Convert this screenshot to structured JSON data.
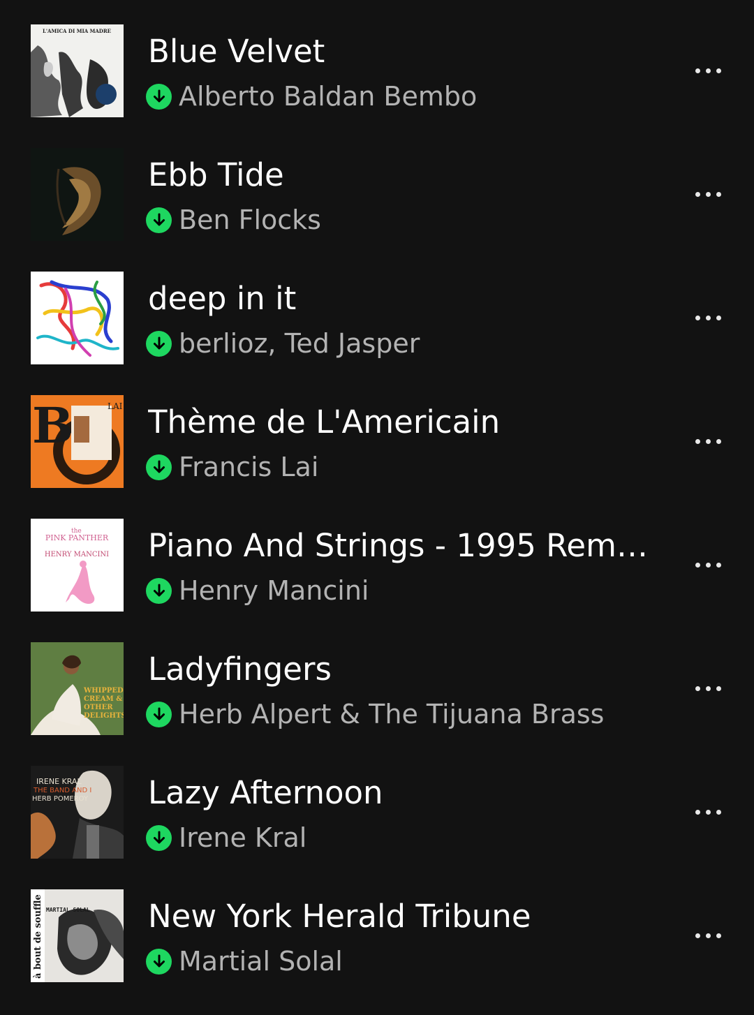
{
  "tracks": [
    {
      "title": "Blue Velvet",
      "artist": "Alberto Baldan Bembo",
      "cover_text": [
        "L'AMICA DI MIA MADRE"
      ]
    },
    {
      "title": "Ebb Tide",
      "artist": "Ben Flocks",
      "cover_text": []
    },
    {
      "title": "deep in it",
      "artist": "berlioz, Ted Jasper",
      "cover_text": []
    },
    {
      "title": "Thème de L'Americain",
      "artist": "Francis Lai",
      "cover_text": [
        "B",
        "O",
        "LAI"
      ]
    },
    {
      "title": "Piano And Strings - 1995 Rema...",
      "artist": "Henry Mancini",
      "cover_text": [
        "the",
        "PINK PANTHER",
        "HENRY MANCINI"
      ]
    },
    {
      "title": "Ladyfingers",
      "artist": "Herb Alpert & The Tijuana Brass",
      "cover_text": [
        "WHIPPED",
        "CREAM &",
        "OTHER",
        "DELIGHTS"
      ]
    },
    {
      "title": "Lazy Afternoon",
      "artist": "Irene Kral",
      "cover_text": [
        "IRENE KRAL",
        "THE BAND AND I",
        "HERB POMEROY"
      ]
    },
    {
      "title": "New York Herald Tribune",
      "artist": "Martial Solal",
      "cover_text": [
        "à bout de souffle",
        "MARTIAL SOLAL"
      ]
    }
  ],
  "icons": {
    "download": "download-icon",
    "more": "more-options-icon"
  },
  "colors": {
    "background": "#121212",
    "accent": "#1ed760",
    "title": "#ffffff",
    "subtitle": "#b3b3b3"
  }
}
